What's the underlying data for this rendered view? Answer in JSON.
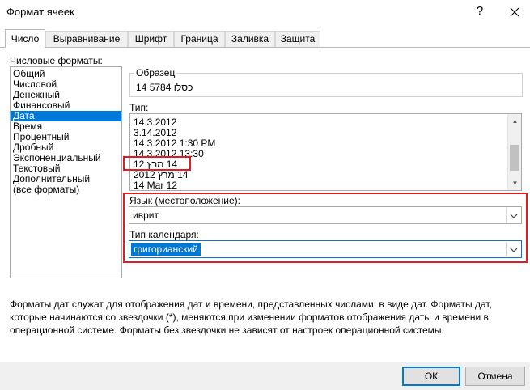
{
  "window": {
    "title": "Формат ячеек",
    "help_label": "?"
  },
  "tabs": [
    {
      "label": "Число"
    },
    {
      "label": "Выравнивание"
    },
    {
      "label": "Шрифт"
    },
    {
      "label": "Граница"
    },
    {
      "label": "Заливка"
    },
    {
      "label": "Защита"
    }
  ],
  "categories": {
    "label": "Числовые форматы:",
    "items": [
      {
        "label": "Общий"
      },
      {
        "label": "Числовой"
      },
      {
        "label": "Денежный"
      },
      {
        "label": "Финансовый"
      },
      {
        "label": "Дата"
      },
      {
        "label": "Время"
      },
      {
        "label": "Процентный"
      },
      {
        "label": "Дробный"
      },
      {
        "label": "Экспоненциальный"
      },
      {
        "label": "Текстовый"
      },
      {
        "label": "Дополнительный"
      },
      {
        "label": "(все форматы)"
      }
    ],
    "selected": "Дата"
  },
  "sample": {
    "label": "Образец",
    "value": "14 כסלו 5784"
  },
  "type": {
    "label": "Тип:",
    "items": [
      {
        "label": "14.3.2012"
      },
      {
        "label": "3.14.2012"
      },
      {
        "label": "14.3.2012 1:30 PM"
      },
      {
        "label": "14.3.2012 13:30"
      },
      {
        "label": "14 מרץ 12"
      },
      {
        "label": "14 מרץ 2012"
      },
      {
        "label": "14 Mar 12"
      }
    ]
  },
  "locale": {
    "label": "Язык (местоположение):",
    "value": "иврит"
  },
  "calendar": {
    "label": "Тип календаря:",
    "value": "григорианский"
  },
  "description": "Форматы дат служат для отображения дат и времени, представленных числами, в виде дат. Форматы дат, которые начинаются со звездочки (*), меняются при изменении форматов отображения даты и времени в операционной системе. Форматы без звездочки не зависят от настроек операционной системы.",
  "buttons": {
    "ok": "ОК",
    "cancel": "Отмена"
  },
  "colors": {
    "highlight": "#e21b22",
    "selection": "#0078d7"
  }
}
